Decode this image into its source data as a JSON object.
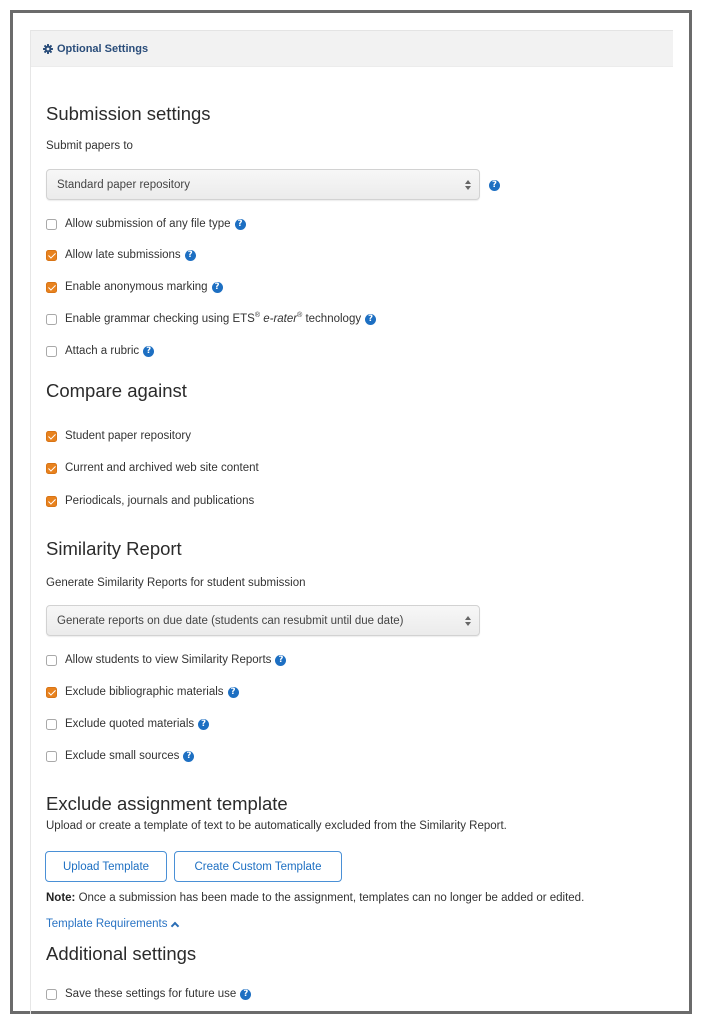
{
  "header": {
    "icon": "gear-icon",
    "title": "Optional Settings"
  },
  "submission": {
    "heading": "Submission settings",
    "submit_to_label": "Submit papers to",
    "submit_to_value": "Standard paper repository",
    "options": [
      {
        "label": "Allow submission of any file type",
        "checked": false,
        "help": true
      },
      {
        "label": "Allow late submissions",
        "checked": true,
        "help": true
      },
      {
        "label": "Enable anonymous marking",
        "checked": true,
        "help": true
      },
      {
        "label_parts": {
          "pre": "Enable grammar checking using ETS",
          "reg1": "®",
          "mid": " ",
          "italic": "e-rater",
          "reg2": "®",
          "post": " technology"
        },
        "checked": false,
        "help": true
      },
      {
        "label": "Attach a rubric",
        "checked": false,
        "help": true
      }
    ]
  },
  "compare": {
    "heading": "Compare against",
    "options": [
      {
        "label": "Student paper repository",
        "checked": true
      },
      {
        "label": "Current and archived web site content",
        "checked": true
      },
      {
        "label": "Periodicals, journals and publications",
        "checked": true
      }
    ]
  },
  "similarity": {
    "heading": "Similarity Report",
    "generate_label": "Generate Similarity Reports for student submission",
    "generate_value": "Generate reports on due date (students can resubmit until due date)",
    "options": [
      {
        "label": "Allow students to view Similarity Reports",
        "checked": false,
        "help": true
      },
      {
        "label": "Exclude bibliographic materials",
        "checked": true,
        "help": true
      },
      {
        "label": "Exclude quoted materials",
        "checked": false,
        "help": true
      },
      {
        "label": "Exclude small sources",
        "checked": false,
        "help": true
      }
    ]
  },
  "template": {
    "heading": "Exclude assignment template",
    "description": "Upload or create a template of text to be automatically excluded from the Similarity Report.",
    "upload_button": "Upload Template",
    "create_button": "Create Custom Template",
    "note_label": "Note:",
    "note_text": " Once a submission has been made to the assignment, templates can no longer be added or edited.",
    "requirements_link": "Template Requirements",
    "requirements_icon": "chevron-up-icon"
  },
  "additional": {
    "heading": "Additional settings",
    "options": [
      {
        "label": "Save these settings for future use",
        "checked": false,
        "help": true
      }
    ]
  },
  "help_glyph": "?",
  "colors": {
    "accent_checkbox": "#e8821e",
    "link_blue": "#1d6fc2",
    "header_text": "#2a4d7a"
  }
}
